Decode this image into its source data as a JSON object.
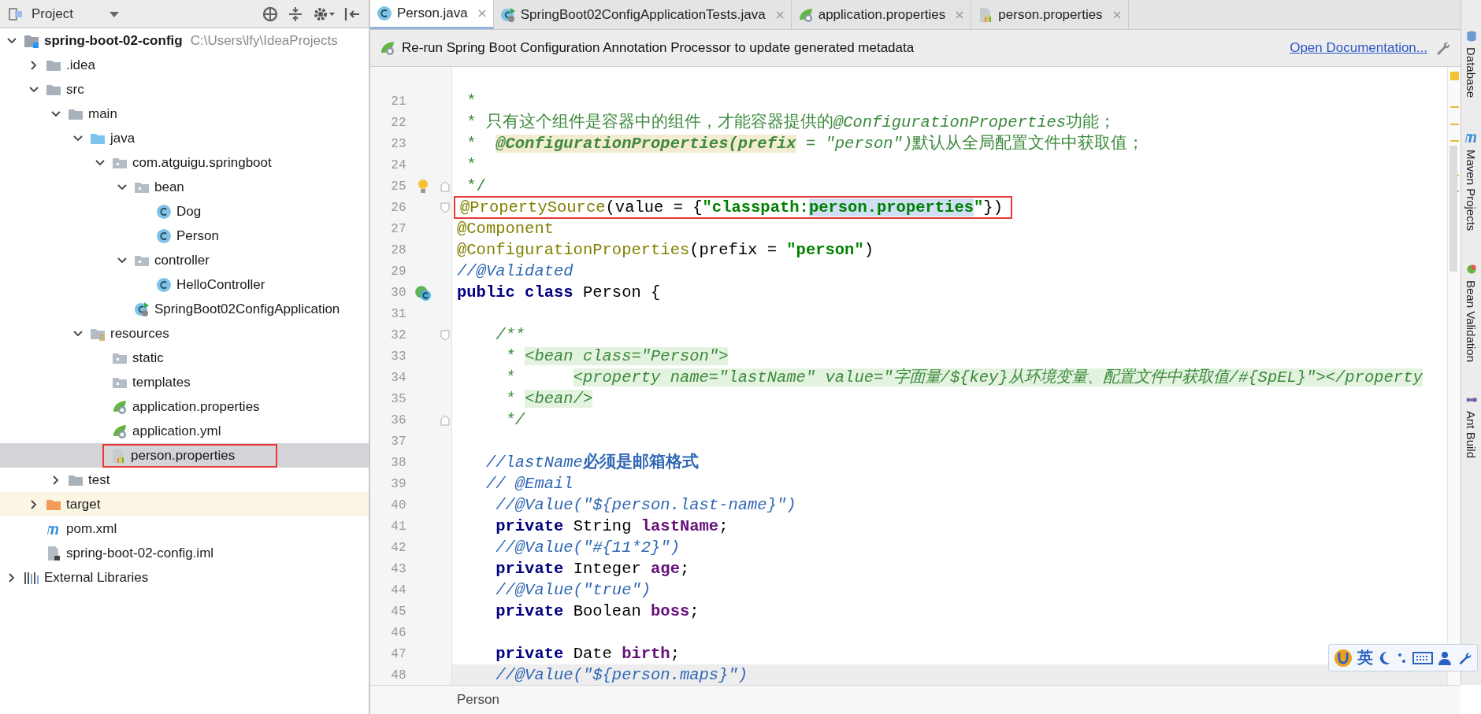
{
  "project_panel": {
    "title": "Project",
    "tree": [
      {
        "label": "spring-boot-02-config",
        "path": "C:\\Users\\lfy\\IdeaProjects",
        "kind": "module",
        "expanded": true,
        "selected": false,
        "children": [
          {
            "label": ".idea",
            "kind": "folder",
            "expanded": false,
            "selected": false
          },
          {
            "label": "src",
            "kind": "folder",
            "expanded": true,
            "selected": false,
            "children": [
              {
                "label": "main",
                "kind": "folder",
                "expanded": true,
                "selected": false,
                "children": [
                  {
                    "label": "java",
                    "kind": "source-folder",
                    "expanded": true,
                    "selected": false,
                    "children": [
                      {
                        "label": "com.atguigu.springboot",
                        "kind": "package",
                        "expanded": true,
                        "selected": false,
                        "children": [
                          {
                            "label": "bean",
                            "kind": "package",
                            "expanded": true,
                            "selected": false,
                            "children": [
                              {
                                "label": "Dog",
                                "kind": "class",
                                "selected": false
                              },
                              {
                                "label": "Person",
                                "kind": "class",
                                "selected": false
                              }
                            ]
                          },
                          {
                            "label": "controller",
                            "kind": "package",
                            "expanded": true,
                            "selected": false,
                            "children": [
                              {
                                "label": "HelloController",
                                "kind": "class",
                                "selected": false
                              }
                            ]
                          },
                          {
                            "label": "SpringBoot02ConfigApplication",
                            "kind": "spring-app",
                            "selected": false
                          }
                        ]
                      }
                    ]
                  },
                  {
                    "label": "resources",
                    "kind": "resources-folder",
                    "expanded": true,
                    "selected": false,
                    "children": [
                      {
                        "label": "static",
                        "kind": "package",
                        "selected": false
                      },
                      {
                        "label": "templates",
                        "kind": "package",
                        "selected": false
                      },
                      {
                        "label": "application.properties",
                        "kind": "spring-config",
                        "selected": false
                      },
                      {
                        "label": "application.yml",
                        "kind": "spring-config",
                        "selected": false
                      },
                      {
                        "label": "person.properties",
                        "kind": "properties",
                        "selected": true,
                        "boxed": true
                      }
                    ]
                  }
                ]
              },
              {
                "label": "test",
                "kind": "folder",
                "expanded": false,
                "selected": false
              }
            ]
          },
          {
            "label": "target",
            "kind": "excluded-folder",
            "expanded": false,
            "selected": false
          },
          {
            "label": "pom.xml",
            "kind": "maven",
            "selected": false
          },
          {
            "label": "spring-boot-02-config.iml",
            "kind": "iml",
            "selected": false
          }
        ]
      },
      {
        "label": "External Libraries",
        "kind": "libraries",
        "expanded": false,
        "selected": false
      }
    ]
  },
  "editor_tabs": [
    {
      "label": "Person.java",
      "kind": "class",
      "selected": true
    },
    {
      "label": "SpringBoot02ConfigApplicationTests.java",
      "kind": "spring-app",
      "selected": false
    },
    {
      "label": "application.properties",
      "kind": "spring-config",
      "selected": false
    },
    {
      "label": "person.properties",
      "kind": "properties",
      "selected": false
    }
  ],
  "notification": {
    "message": "Re-run Spring Boot Configuration Annotation Processor to update generated metadata",
    "link": "Open Documentation..."
  },
  "code_lines": [
    {
      "number": "21",
      "tokens": [
        {
          "kind": "doc",
          "text": " *"
        }
      ]
    },
    {
      "number": "22",
      "tokens": [
        {
          "kind": "doc",
          "text": " * 只有这个组件是容器中的组件，才能容器提供的"
        },
        {
          "kind": "doc-italic",
          "text": "@ConfigurationProperties"
        },
        {
          "kind": "doc",
          "text": "功能；"
        }
      ]
    },
    {
      "number": "23",
      "tokens": [
        {
          "kind": "doc",
          "text": " *  "
        },
        {
          "kind": "doc-tag",
          "text": "@ConfigurationProperties(prefix"
        },
        {
          "kind": "doc-italic",
          "text": " = \"person\")"
        },
        {
          "kind": "doc",
          "text": "默认从全局配置文件中获取值；"
        }
      ]
    },
    {
      "number": "24",
      "tokens": [
        {
          "kind": "doc",
          "text": " *"
        }
      ]
    },
    {
      "number": "25",
      "bulb": true,
      "fold_end": true,
      "tokens": [
        {
          "kind": "doc",
          "text": " */"
        }
      ]
    },
    {
      "number": "26",
      "fold_start": true,
      "boxed": true,
      "tokens": [
        {
          "kind": "annotation",
          "text": "@PropertySource"
        },
        {
          "kind": "plain",
          "text": "(value = {"
        },
        {
          "kind": "string",
          "text": "\"classpath:"
        },
        {
          "kind": "string-selected",
          "text": "person.properties"
        },
        {
          "kind": "string",
          "text": "\""
        },
        {
          "kind": "plain",
          "text": "})"
        }
      ]
    },
    {
      "number": "27",
      "tokens": [
        {
          "kind": "annotation",
          "text": "@Component"
        }
      ]
    },
    {
      "number": "28",
      "tokens": [
        {
          "kind": "annotation",
          "text": "@ConfigurationProperties"
        },
        {
          "kind": "plain",
          "text": "(prefix = "
        },
        {
          "kind": "string",
          "text": "\"person\""
        },
        {
          "kind": "plain",
          "text": ")"
        }
      ]
    },
    {
      "number": "29",
      "tokens": [
        {
          "kind": "comment",
          "text": "//@Validated"
        }
      ]
    },
    {
      "number": "30",
      "class_marker": true,
      "tokens": [
        {
          "kind": "keyword",
          "text": "public class"
        },
        {
          "kind": "plain",
          "text": " Person {"
        }
      ]
    },
    {
      "number": "31"
    },
    {
      "number": "32",
      "fold_start": true,
      "tokens": [
        {
          "kind": "doc-italic",
          "text": "    /**"
        }
      ]
    },
    {
      "number": "33",
      "tokens": [
        {
          "kind": "doc-italic",
          "text": "     * "
        },
        {
          "kind": "xml",
          "text": "<bean class=\"Person\">"
        }
      ]
    },
    {
      "number": "34",
      "tokens": [
        {
          "kind": "doc-italic",
          "text": "     *      "
        },
        {
          "kind": "xml",
          "text": "<property name=\"lastName\" value=\"字面量/${key}从环境变量、配置文件中获取值/#{SpEL}\"></property"
        }
      ]
    },
    {
      "number": "35",
      "tokens": [
        {
          "kind": "doc-italic",
          "text": "     * "
        },
        {
          "kind": "xml",
          "text": "<bean/>"
        }
      ]
    },
    {
      "number": "36",
      "fold_end": true,
      "tokens": [
        {
          "kind": "doc-italic",
          "text": "     */"
        }
      ]
    },
    {
      "number": "37"
    },
    {
      "number": "38",
      "tokens": [
        {
          "kind": "comment",
          "text": "   //lastName"
        },
        {
          "kind": "comment-bold",
          "text": "必须是邮箱格式"
        }
      ]
    },
    {
      "number": "39",
      "tokens": [
        {
          "kind": "comment",
          "text": "   // @Email"
        }
      ]
    },
    {
      "number": "40",
      "tokens": [
        {
          "kind": "comment",
          "text": "    //@Value(\"${person.last-name}\")"
        }
      ]
    },
    {
      "number": "41",
      "tokens": [
        {
          "kind": "keyword",
          "text": "    private"
        },
        {
          "kind": "plain",
          "text": " String "
        },
        {
          "kind": "field",
          "text": "lastName"
        },
        {
          "kind": "plain",
          "text": ";"
        }
      ]
    },
    {
      "number": "42",
      "tokens": [
        {
          "kind": "comment",
          "text": "    //@Value(\"#{11*2}\")"
        }
      ]
    },
    {
      "number": "43",
      "tokens": [
        {
          "kind": "keyword",
          "text": "    private"
        },
        {
          "kind": "plain",
          "text": " Integer "
        },
        {
          "kind": "field",
          "text": "age"
        },
        {
          "kind": "plain",
          "text": ";"
        }
      ]
    },
    {
      "number": "44",
      "tokens": [
        {
          "kind": "comment",
          "text": "    //@Value(\"true\")"
        }
      ]
    },
    {
      "number": "45",
      "tokens": [
        {
          "kind": "keyword",
          "text": "    private"
        },
        {
          "kind": "plain",
          "text": " Boolean "
        },
        {
          "kind": "field",
          "text": "boss"
        },
        {
          "kind": "plain",
          "text": ";"
        }
      ]
    },
    {
      "number": "46"
    },
    {
      "number": "47",
      "tokens": [
        {
          "kind": "keyword",
          "text": "    private"
        },
        {
          "kind": "plain",
          "text": " Date "
        },
        {
          "kind": "field",
          "text": "birth"
        },
        {
          "kind": "plain",
          "text": ";"
        }
      ]
    },
    {
      "number": "48",
      "current": true,
      "tokens": [
        {
          "kind": "comment",
          "text": "    //@Value(\"${person.maps}\")"
        }
      ]
    }
  ],
  "right_tool_windows": [
    {
      "label": "Database",
      "kind": "database"
    },
    {
      "label": "Maven Projects",
      "kind": "maven"
    },
    {
      "label": "Bean Validation",
      "kind": "bean"
    },
    {
      "label": "Ant Build",
      "kind": "ant"
    }
  ],
  "breadcrumb": "Person",
  "ime_toolbar": {
    "language": "英"
  }
}
